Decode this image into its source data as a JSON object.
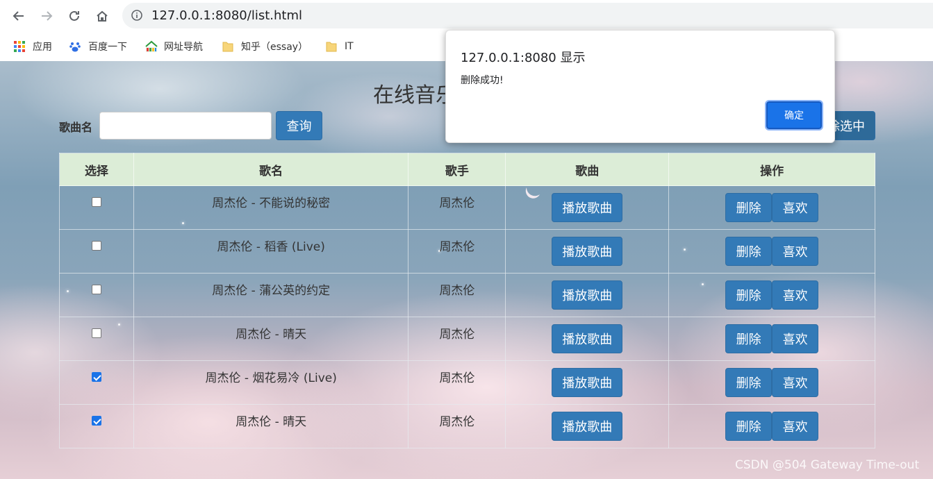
{
  "browser": {
    "url": "127.0.0.1:8080/list.html",
    "bookmarks": [
      "应用",
      "百度一下",
      "网址导航",
      "知乎（essay）",
      "IT"
    ]
  },
  "page": {
    "title": "在线音乐",
    "search_label": "歌曲名",
    "search_value": "",
    "search_button": "查询",
    "delete_selected_button": "删除选中"
  },
  "table": {
    "headers": [
      "选择",
      "歌名",
      "歌手",
      "歌曲",
      "操作"
    ],
    "play_label": "播放歌曲",
    "delete_label": "删除",
    "like_label": "喜欢",
    "rows": [
      {
        "title": "周杰伦 - 不能说的秘密",
        "singer": "周杰伦",
        "checked": false
      },
      {
        "title": "周杰伦 - 稻香 (Live)",
        "singer": "周杰伦",
        "checked": false
      },
      {
        "title": "周杰伦 - 蒲公英的约定",
        "singer": "周杰伦",
        "checked": false
      },
      {
        "title": "周杰伦 - 晴天",
        "singer": "周杰伦",
        "checked": false
      },
      {
        "title": "周杰伦 - 烟花易冷 (Live)",
        "singer": "周杰伦",
        "checked": true
      },
      {
        "title": "周杰伦 - 晴天",
        "singer": "周杰伦",
        "checked": true
      }
    ]
  },
  "dialog": {
    "title": "127.0.0.1:8080 显示",
    "message": "删除成功!",
    "ok_label": "确定"
  },
  "watermark": "CSDN @504 Gateway Time-out",
  "colors": {
    "primary_button": "#337ab7",
    "table_header": "#dff0d8",
    "dialog_button": "#1a73e8"
  }
}
